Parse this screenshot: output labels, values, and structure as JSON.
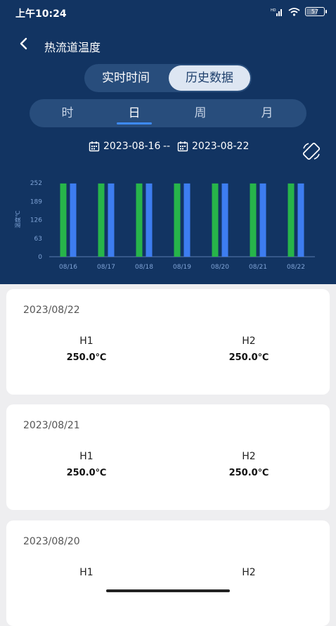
{
  "status": {
    "time": "上午10:24",
    "battery": "57",
    "network": "HD"
  },
  "header": {
    "title": "热流道温度"
  },
  "mode_toggle": {
    "realtime": "实时时间",
    "history": "历史数据",
    "selected": "history"
  },
  "period_tabs": [
    {
      "label": "时",
      "active": false
    },
    {
      "label": "日",
      "active": true
    },
    {
      "label": "周",
      "active": false
    },
    {
      "label": "月",
      "active": false
    }
  ],
  "range": {
    "start": "2023-08-16",
    "separator": "--",
    "end": "2023-08-22"
  },
  "colors": {
    "header_bg": "#123462",
    "series_h1": "#27b54a",
    "series_h2": "#3d7df0",
    "accent": "#3d8af7"
  },
  "chart_data": {
    "type": "bar",
    "ylabel": "温度℃",
    "yticks": [
      "252",
      "189",
      "126",
      "63",
      "0"
    ],
    "ylim": [
      0,
      252
    ],
    "categories": [
      "08/16",
      "08/17",
      "08/18",
      "08/19",
      "08/20",
      "08/21",
      "08/22"
    ],
    "series": [
      {
        "values": [
          250,
          250,
          250,
          250,
          250,
          250,
          250
        ]
      },
      {
        "values": [
          250,
          250,
          250,
          250,
          250,
          250,
          250
        ]
      }
    ],
    "grid": false
  },
  "cards": [
    {
      "date": "2023/08/22",
      "h1_label": "H1",
      "h1_value": "250.0℃",
      "h2_label": "H2",
      "h2_value": "250.0℃"
    },
    {
      "date": "2023/08/21",
      "h1_label": "H1",
      "h1_value": "250.0℃",
      "h2_label": "H2",
      "h2_value": "250.0℃"
    },
    {
      "date": "2023/08/20",
      "h1_label": "H1",
      "h1_value": "",
      "h2_label": "H2",
      "h2_value": ""
    }
  ]
}
